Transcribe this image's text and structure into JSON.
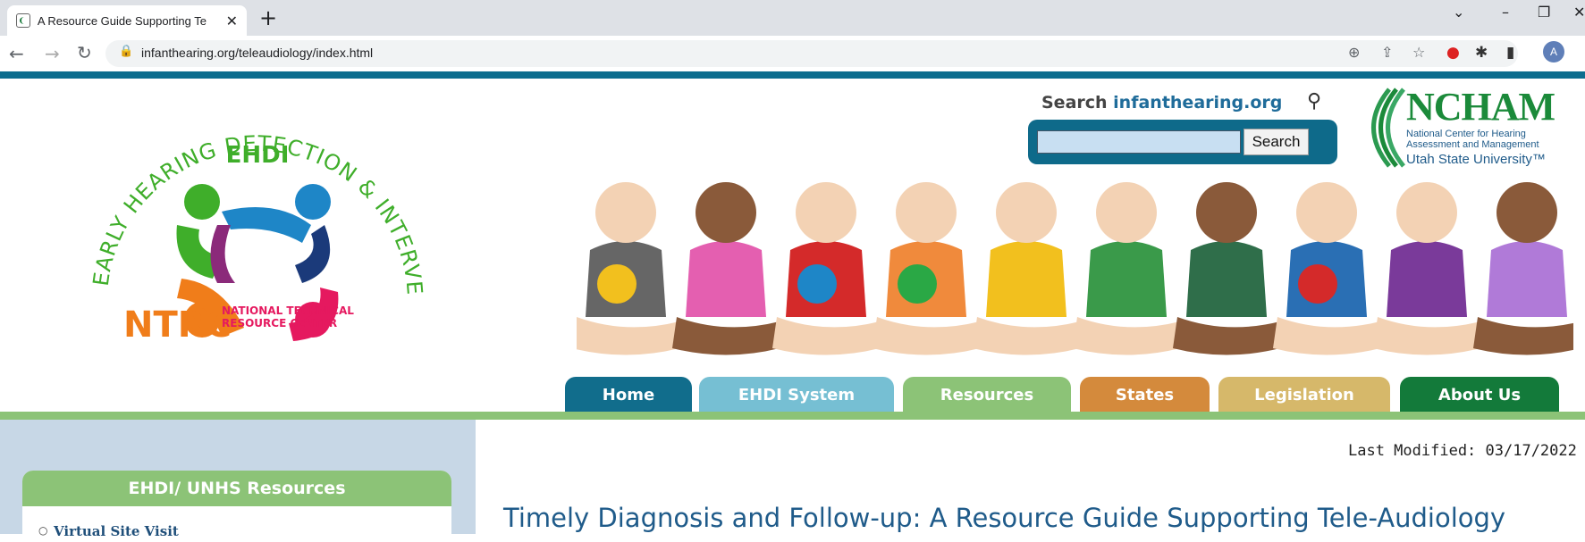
{
  "browser": {
    "tab_title": "A Resource Guide Supporting Te",
    "url": "infanthearing.org/teleaudiology/index.html",
    "avatar_letter": "A"
  },
  "site": {
    "search_label_prefix": "Search ",
    "search_label_site": "infanthearing.org",
    "search_button": "Search",
    "search_value": "",
    "ncham": {
      "title": "NCHAM",
      "line1": "National Center for Hearing",
      "line2": "Assessment and Management",
      "line3": "Utah State University™"
    },
    "ehdi_logo": {
      "arc_text": "EARLY HEARING DETECTION & INTERVENTION",
      "center_text": "EHDI",
      "ntrc": "NTRC",
      "ntrc_line1": "NATIONAL TECHNICAL",
      "ntrc_line2": "RESOURCE CENTER"
    },
    "nav": [
      {
        "label": "Home",
        "color": "#116d8c"
      },
      {
        "label": "EHDI System",
        "color": "#76bfd3"
      },
      {
        "label": "Resources",
        "color": "#8cc377"
      },
      {
        "label": "States",
        "color": "#d48a3c"
      },
      {
        "label": "Legislation",
        "color": "#d6b86a"
      },
      {
        "label": "About Us",
        "color": "#137a3a"
      }
    ],
    "sidebar": {
      "heading": "EHDI/ UNHS Resources",
      "items": [
        "Virtual Site Visit"
      ]
    },
    "last_modified": "Last Modified: 03/17/2022",
    "page_title": "Timely Diagnosis and Follow-up: A Resource Guide Supporting Tele-Audiology"
  }
}
